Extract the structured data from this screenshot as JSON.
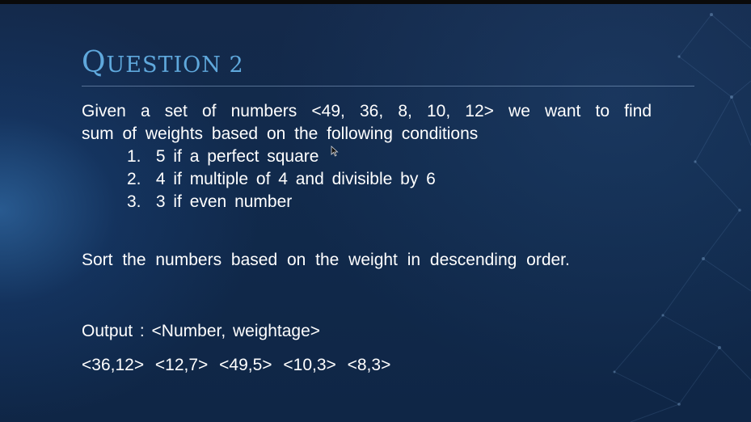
{
  "slide": {
    "title_initial": "Q",
    "title_rest": "uestion 2",
    "intro_line1": "Given a set of numbers <49, 36, 8, 10, 12> we want to find",
    "intro_line2": "sum of weights based on the following conditions",
    "conditions": [
      {
        "number": "1.",
        "text": "5 if a perfect square"
      },
      {
        "number": "2.",
        "text": "4 if multiple of 4 and divisible by 6"
      },
      {
        "number": "3.",
        "text": "3 if even number"
      }
    ],
    "sort_instruction": "Sort the numbers based on the weight in descending order.",
    "output_label": "Output : <Number, weightage>",
    "output_values": "<36,12> <12,7> <49,5> <10,3> <8,3>"
  },
  "colors": {
    "background": "#0e2444",
    "title": "#5fa8dc",
    "text": "#ffffff",
    "divider": "#8caacd"
  },
  "icons": {
    "cursor": "mouse-pointer-icon"
  }
}
